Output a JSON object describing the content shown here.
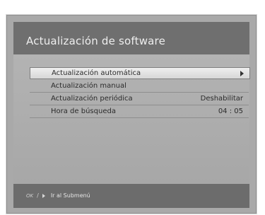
{
  "header": {
    "title": "Actualización de software"
  },
  "menu": {
    "items": [
      {
        "label": "Actualización automática",
        "value": ""
      },
      {
        "label": "Actualización manual",
        "value": ""
      },
      {
        "label": "Actualización periódica",
        "value": "Deshabilitar"
      },
      {
        "label": "Hora de búsqueda",
        "value": "04 : 05"
      }
    ],
    "selected_index": 0
  },
  "footer": {
    "ok_label": "OK",
    "separator": "/",
    "hint": "Ir al Submenú"
  },
  "icons": {
    "submenu_arrow": "right-arrow-icon",
    "hint_ok": "ok-icon",
    "hint_arrow": "right-arrow-icon"
  },
  "colors": {
    "frame": "#a9a9a9",
    "title_bar": "#6f6f6f",
    "selected_row": "#e6e6e6",
    "footer": "#6c6c6c"
  }
}
